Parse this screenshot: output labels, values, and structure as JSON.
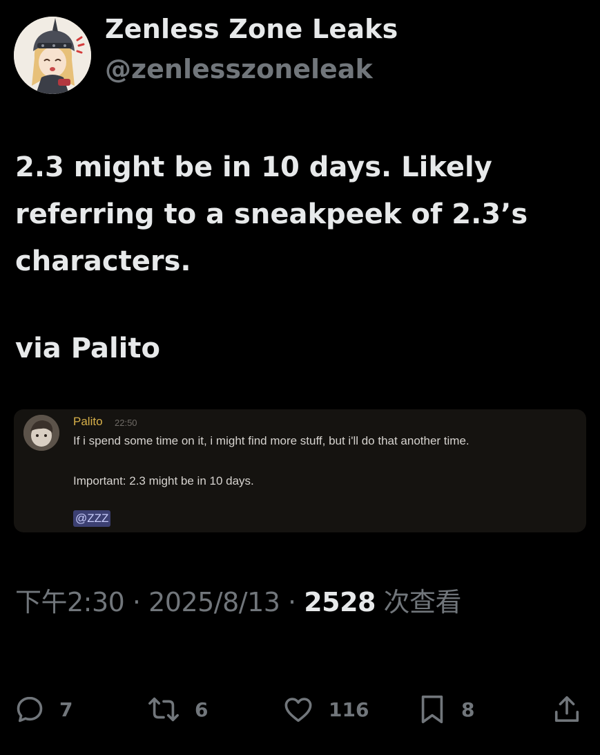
{
  "author": {
    "display_name": "Zenless Zone Leaks",
    "handle": "@zenlesszoneleak"
  },
  "tweet": {
    "text_lines": [
      "2.3 might be in 10 days. Likely",
      "referring to a sneakpeek of 2.3’s",
      "characters."
    ],
    "via": "via Palito"
  },
  "embed": {
    "author": "Palito",
    "time": "22:50",
    "line1": "If i spend some time on it, i might find more stuff, but i'll do that another time.",
    "line2": "Important: 2.3 might be in 10 days.",
    "mention": "@ZZZ"
  },
  "meta": {
    "time": "下午2:30",
    "separator": " · ",
    "date": "2025/8/13",
    "views_count": "2528",
    "views_label": " 次查看"
  },
  "actions": {
    "replies": "7",
    "reposts": "6",
    "likes": "116",
    "bookmarks": "8"
  },
  "colors": {
    "background": "#000000",
    "text_primary": "#e7e9ea",
    "text_secondary": "#71767b",
    "embed_bg": "#151310",
    "embed_author": "#d8b14a",
    "mention_bg": "#3c4072"
  }
}
